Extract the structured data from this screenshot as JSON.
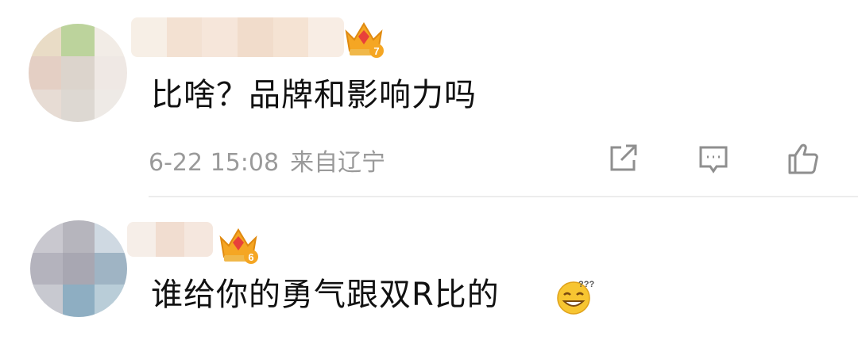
{
  "comments": [
    {
      "badge_level": "7",
      "text": "比啥？品牌和影响力吗",
      "date": "6-22 15:08",
      "location": "来自辽宁"
    },
    {
      "badge_level": "6",
      "text": "谁给你的勇气跟双R比的",
      "emoji": "smiling-squint-emoji"
    }
  ],
  "actions": [
    "share-icon",
    "comment-icon",
    "like-icon"
  ],
  "colors": {
    "meta_text": "#9a9a9a",
    "divider": "#ececec",
    "crown": "#f5a623",
    "crown_gem": "#e8413a"
  }
}
